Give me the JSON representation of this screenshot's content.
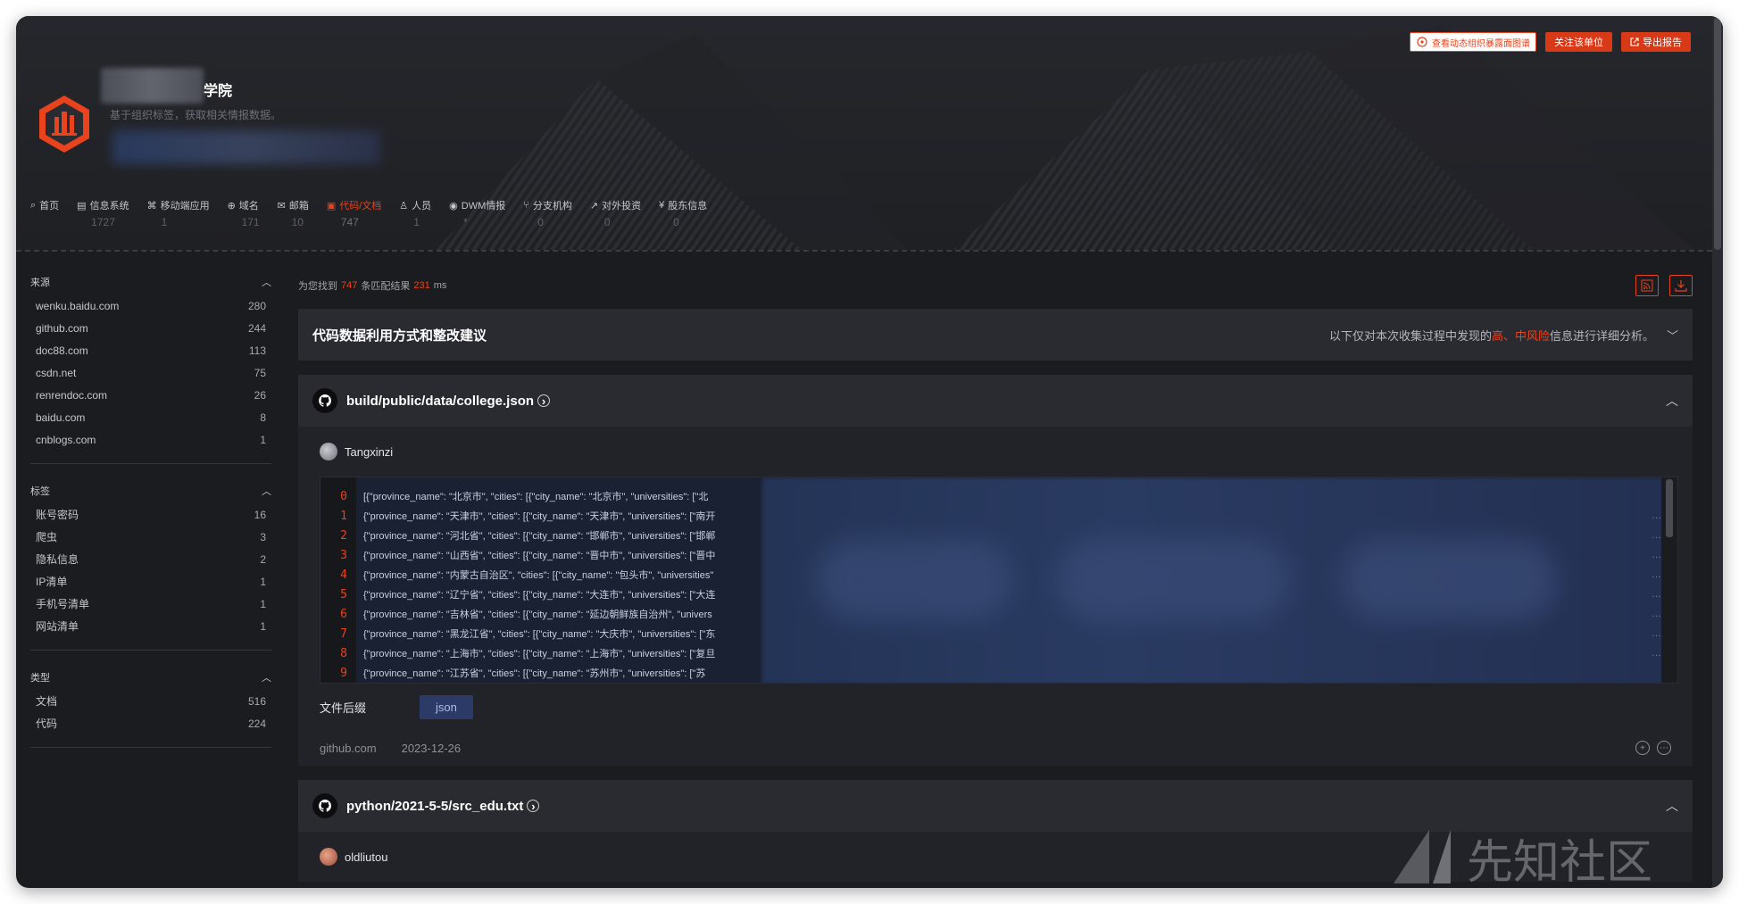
{
  "org": {
    "name": "学院",
    "desc": "基于组织标签，获取相关情报数据。"
  },
  "actions": {
    "promo": "查看动态组织暴露面图谱",
    "follow": "关注该单位",
    "export": "导出报告"
  },
  "tabs": [
    {
      "label": "首页",
      "count": ""
    },
    {
      "label": "信息系统",
      "count": "1727"
    },
    {
      "label": "移动端应用",
      "count": "1"
    },
    {
      "label": "域名",
      "count": "171"
    },
    {
      "label": "邮箱",
      "count": "10"
    },
    {
      "label": "代码/文档",
      "count": "747"
    },
    {
      "label": "人员",
      "count": "1"
    },
    {
      "label": "DWM情报",
      "count": "*"
    },
    {
      "label": "分支机构",
      "count": "0"
    },
    {
      "label": "对外投资",
      "count": "0"
    },
    {
      "label": "股东信息",
      "count": "0"
    }
  ],
  "sidebar": {
    "sources": {
      "title": "来源",
      "items": [
        {
          "name": "wenku.baidu.com",
          "count": "280"
        },
        {
          "name": "github.com",
          "count": "244"
        },
        {
          "name": "doc88.com",
          "count": "113"
        },
        {
          "name": "csdn.net",
          "count": "75"
        },
        {
          "name": "renrendoc.com",
          "count": "26"
        },
        {
          "name": "baidu.com",
          "count": "8"
        },
        {
          "name": "cnblogs.com",
          "count": "1"
        }
      ]
    },
    "tags": {
      "title": "标签",
      "items": [
        {
          "name": "账号密码",
          "count": "16"
        },
        {
          "name": "爬虫",
          "count": "3"
        },
        {
          "name": "隐私信息",
          "count": "2"
        },
        {
          "name": "IP清单",
          "count": "1"
        },
        {
          "name": "手机号清单",
          "count": "1"
        },
        {
          "name": "网站清单",
          "count": "1"
        }
      ]
    },
    "types": {
      "title": "类型",
      "items": [
        {
          "name": "文档",
          "count": "516"
        },
        {
          "name": "代码",
          "count": "224"
        }
      ]
    }
  },
  "results": {
    "prefix": "为您找到",
    "count": "747",
    "mid": "条匹配结果",
    "ms": "231",
    "unit": "ms"
  },
  "advice": {
    "title": "代码数据利用方式和整改建议",
    "note_a": "以下仅对本次收集过程中发现的",
    "note_high": "高、中风险",
    "note_b": "信息进行详细分析。"
  },
  "repo1": {
    "path": "build/public/data/college.json",
    "user": "Tangxinzi",
    "lines": [
      {
        "n": "0",
        "text": "[{\"province_name\": \"北京市\", \"cities\": [{\"city_name\": \"北京市\", \"universities\": [\"北"
      },
      {
        "n": "1",
        "text": "{\"province_name\": \"天津市\", \"cities\": [{\"city_name\": \"天津市\", \"universities\": [\"南开"
      },
      {
        "n": "2",
        "text": "{\"province_name\": \"河北省\", \"cities\": [{\"city_name\": \"邯郸市\", \"universities\": [\"邯郸"
      },
      {
        "n": "3",
        "text": "{\"province_name\": \"山西省\", \"cities\": [{\"city_name\": \"晋中市\", \"universities\": [\"晋中"
      },
      {
        "n": "4",
        "text": "{\"province_name\": \"内蒙古自治区\", \"cities\": [{\"city_name\": \"包头市\", \"universities\""
      },
      {
        "n": "5",
        "text": "{\"province_name\": \"辽宁省\", \"cities\": [{\"city_name\": \"大连市\", \"universities\": [\"大连"
      },
      {
        "n": "6",
        "text": "{\"province_name\": \"吉林省\", \"cities\": [{\"city_name\": \"延边朝鲜族自治州\", \"univers"
      },
      {
        "n": "7",
        "text": "{\"province_name\": \"黑龙江省\", \"cities\": [{\"city_name\": \"大庆市\", \"universities\": [\"东"
      },
      {
        "n": "8",
        "text": "{\"province_name\": \"上海市\", \"cities\": [{\"city_name\": \"上海市\", \"universities\": [\"复旦"
      },
      {
        "n": "9",
        "text": "{\"province_name\": \"江苏省\", \"cities\": [{\"city_name\": \"苏州市\", \"universities\": [\"苏"
      }
    ],
    "suffix_label": "文件后缀",
    "suffix": "json",
    "source": "github.com",
    "date": "2023-12-26"
  },
  "repo2": {
    "path": "python/2021-5-5/src_edu.txt",
    "user": "oldliutou"
  },
  "watermark": "先知社区",
  "colors": {
    "accent": "#e8431d",
    "bg": "#1b1c20",
    "panel": "#2a2b31"
  }
}
